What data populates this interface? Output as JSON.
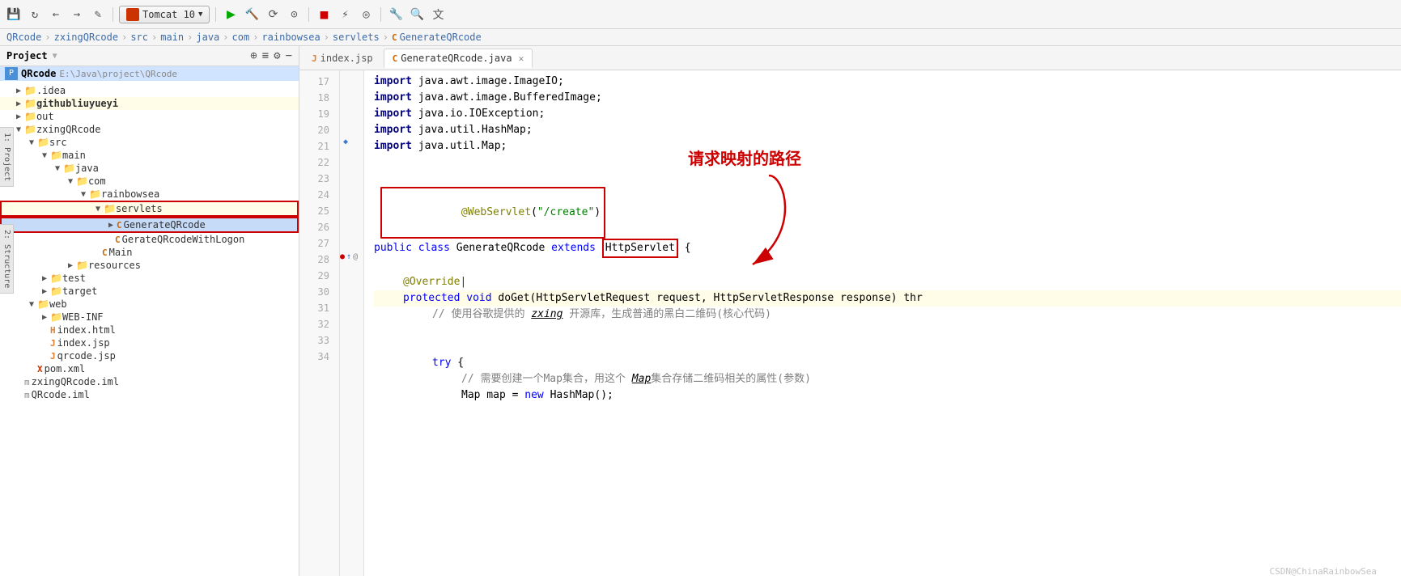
{
  "toolbar": {
    "tomcat_label": "Tomcat 10",
    "icons": [
      "save",
      "refresh",
      "back",
      "forward",
      "pencil",
      "run",
      "build",
      "reload",
      "dropdown",
      "stop",
      "profile",
      "coverage",
      "settings",
      "search",
      "translate"
    ]
  },
  "breadcrumb": {
    "items": [
      "QRcode",
      "zxingQRcode",
      "src",
      "main",
      "java",
      "com",
      "rainbowsea",
      "servlets",
      "GenerateQRcode"
    ]
  },
  "sidebar": {
    "title": "Project",
    "root_label": "QRcode",
    "root_path": "E:\\Java\\project\\QRcode",
    "items": [
      {
        "indent": 0,
        "arrow": "",
        "icon": "folder",
        "label": ".idea",
        "type": "folder"
      },
      {
        "indent": 0,
        "arrow": "",
        "icon": "folder",
        "label": "githubliuyueyi",
        "type": "folder",
        "bold": true
      },
      {
        "indent": 0,
        "arrow": "",
        "icon": "folder",
        "label": "out",
        "type": "folder"
      },
      {
        "indent": 0,
        "arrow": "▼",
        "icon": "folder",
        "label": "zxingQRcode",
        "type": "folder"
      },
      {
        "indent": 1,
        "arrow": "▼",
        "icon": "folder",
        "label": "src",
        "type": "folder"
      },
      {
        "indent": 2,
        "arrow": "▼",
        "icon": "folder",
        "label": "main",
        "type": "folder"
      },
      {
        "indent": 3,
        "arrow": "▼",
        "icon": "folder",
        "label": "java",
        "type": "folder"
      },
      {
        "indent": 4,
        "arrow": "▼",
        "icon": "folder",
        "label": "com",
        "type": "folder"
      },
      {
        "indent": 5,
        "arrow": "▼",
        "icon": "folder",
        "label": "rainbowsea",
        "type": "folder"
      },
      {
        "indent": 6,
        "arrow": "▼",
        "icon": "folder",
        "label": "servlets",
        "type": "folder",
        "highlighted": true
      },
      {
        "indent": 7,
        "arrow": "▶",
        "icon": "class",
        "label": "GenerateQRcode",
        "type": "class",
        "selected": true,
        "highlighted": true
      },
      {
        "indent": 7,
        "arrow": "",
        "icon": "class",
        "label": "GerateQRcodeWithLogon",
        "type": "class"
      },
      {
        "indent": 6,
        "arrow": "",
        "icon": "class",
        "label": "Main",
        "type": "class"
      },
      {
        "indent": 4,
        "arrow": "",
        "icon": "folder",
        "label": "resources",
        "type": "folder"
      },
      {
        "indent": 3,
        "arrow": "",
        "icon": "folder",
        "label": "test",
        "type": "folder"
      },
      {
        "indent": 2,
        "arrow": "",
        "icon": "folder",
        "label": "target",
        "type": "folder"
      },
      {
        "indent": 1,
        "arrow": "▼",
        "icon": "folder",
        "label": "web",
        "type": "folder"
      },
      {
        "indent": 2,
        "arrow": "",
        "icon": "folder",
        "label": "WEB-INF",
        "type": "folder"
      },
      {
        "indent": 2,
        "arrow": "",
        "icon": "file",
        "label": "index.html",
        "type": "html"
      },
      {
        "indent": 2,
        "arrow": "",
        "icon": "file",
        "label": "index.jsp",
        "type": "jsp"
      },
      {
        "indent": 2,
        "arrow": "",
        "icon": "file",
        "label": "qrcode.jsp",
        "type": "jsp"
      },
      {
        "indent": 1,
        "arrow": "",
        "icon": "file",
        "label": "pom.xml",
        "type": "xml"
      },
      {
        "indent": 0,
        "arrow": "",
        "icon": "file",
        "label": "zxingQRcode.iml",
        "type": "iml"
      },
      {
        "indent": 0,
        "arrow": "",
        "icon": "file",
        "label": "QRcode.iml",
        "type": "iml"
      }
    ]
  },
  "tabs": [
    {
      "label": "index.jsp",
      "type": "jsp",
      "active": false
    },
    {
      "label": "GenerateQRcode.java",
      "type": "java",
      "active": true
    }
  ],
  "code_lines": [
    {
      "num": 17,
      "content": "import java.awt.image.ImageIO;",
      "type": "import"
    },
    {
      "num": 18,
      "content": "import java.awt.image.BufferedImage;",
      "type": "import"
    },
    {
      "num": 19,
      "content": "import java.io.IOException;",
      "type": "import"
    },
    {
      "num": 20,
      "content": "import java.util.HashMap;",
      "type": "import"
    },
    {
      "num": 21,
      "content": "import java.util.Map;",
      "type": "import"
    },
    {
      "num": 22,
      "content": "",
      "type": "blank"
    },
    {
      "num": 23,
      "content": "",
      "type": "blank"
    },
    {
      "num": 24,
      "content": "@WebServlet(\"/create\")",
      "type": "annotation_line",
      "annotation": true
    },
    {
      "num": 25,
      "content": "public class GenerateQRcode extends HttpServlet {",
      "type": "class_decl"
    },
    {
      "num": 26,
      "content": "",
      "type": "blank"
    },
    {
      "num": 27,
      "content": "    @Override",
      "type": "override"
    },
    {
      "num": 28,
      "content": "    protected void doGet(HttpServletRequest request, HttpServletResponse response) thr",
      "type": "method",
      "has_gutter": true
    },
    {
      "num": 29,
      "content": "        // 使用谷歌提供的 zxing 开源库，生成普通的黑白二维码(核心代码)",
      "type": "comment"
    },
    {
      "num": 30,
      "content": "",
      "type": "blank"
    },
    {
      "num": 31,
      "content": "",
      "type": "blank"
    },
    {
      "num": 32,
      "content": "        try {",
      "type": "code"
    },
    {
      "num": 33,
      "content": "            // 需要创建一个Map集合，用这个 Map集合存储二维码相关的属性(参数)",
      "type": "comment"
    },
    {
      "num": 34,
      "content": "            Map map = new HashMap();",
      "type": "code"
    }
  ],
  "annotation": {
    "text": "请求映射的路径",
    "arrow_label": "→"
  },
  "watermark": "CSDN@ChinaRainbowSea"
}
